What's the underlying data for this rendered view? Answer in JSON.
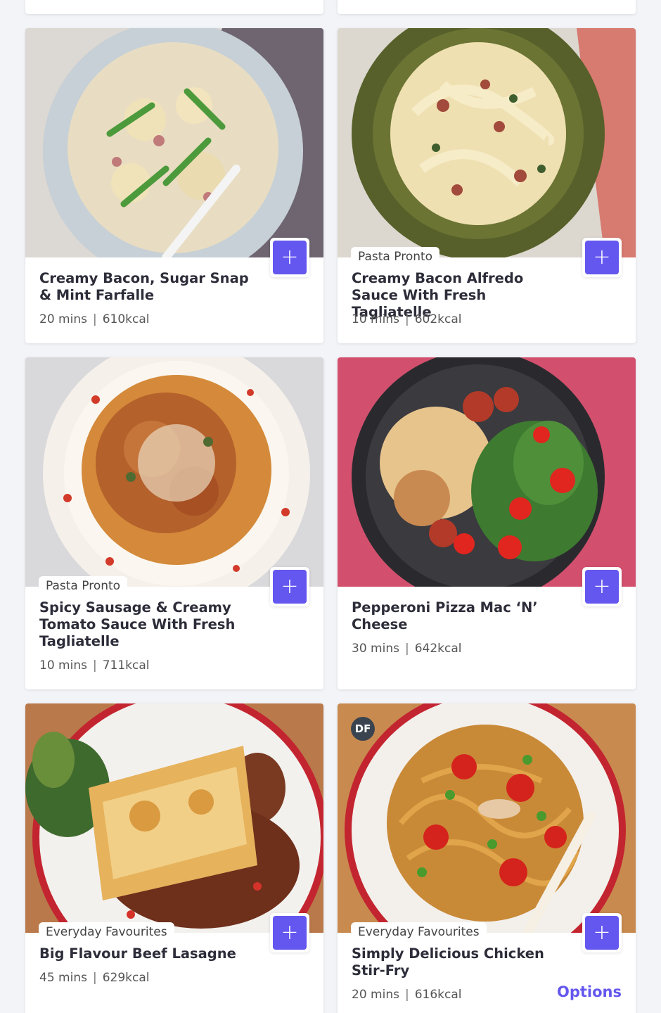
{
  "recipes": [
    {
      "title": "Creamy Bacon, Sugar Snap & Mint Farfalle",
      "time": "20 mins",
      "kcal": "610kcal",
      "tag": "",
      "add_label": "+"
    },
    {
      "title": "Creamy Bacon Alfredo Sauce With Fresh Tagliatelle",
      "time": "10 mins",
      "kcal": "602kcal",
      "tag": "Pasta Pronto",
      "add_label": "+"
    },
    {
      "title": "Spicy Sausage & Creamy Tomato Sauce With Fresh Tagliatelle",
      "time": "10 mins",
      "kcal": "711kcal",
      "tag": "Pasta Pronto",
      "add_label": "+"
    },
    {
      "title": "Pepperoni Pizza Mac ‘N’ Cheese",
      "time": "30 mins",
      "kcal": "642kcal",
      "tag": "",
      "add_label": "+"
    },
    {
      "title": "Big Flavour Beef Lasagne",
      "time": "45 mins",
      "kcal": "629kcal",
      "tag": "Everyday Favourites",
      "add_label": "+"
    },
    {
      "title": "Simply Delicious Chicken Stir-Fry",
      "time": "20 mins",
      "kcal": "616kcal",
      "tag": "Everyday Favourites",
      "add_label": "+",
      "badge": "DF",
      "options_label": "Options"
    }
  ],
  "separator": "|",
  "colors": {
    "accent": "#6457ef",
    "background": "#f3f4f8"
  }
}
